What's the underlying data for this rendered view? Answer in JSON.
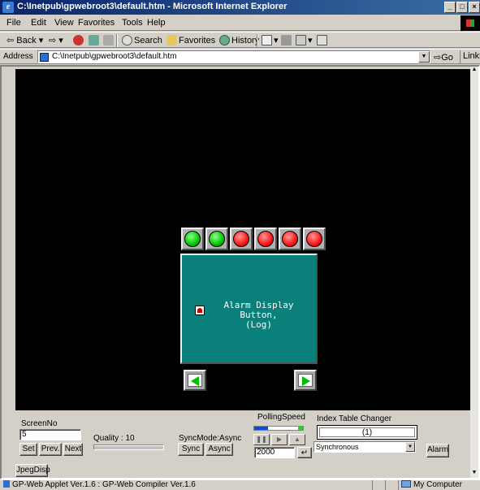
{
  "window": {
    "title": "C:\\Inetpub\\gpwebroot3\\default.htm - Microsoft Internet Explorer"
  },
  "menu": [
    "File",
    "Edit",
    "View",
    "Favorites",
    "Tools",
    "Help"
  ],
  "toolbar": {
    "back": "Back",
    "search": "Search",
    "favorites": "Favorites",
    "history": "History"
  },
  "address": {
    "label": "Address",
    "url": "C:\\Inetpub\\gpwebroot3\\default.htm",
    "go": "Go",
    "links": "Links"
  },
  "screen": {
    "lamps": [
      "green",
      "green",
      "red",
      "red",
      "red",
      "red"
    ],
    "alarm_line1": "Alarm Display Button,",
    "alarm_line2": "(Log)"
  },
  "applet": {
    "screen_no_label": "ScreenNo",
    "screen_no_value": "5",
    "set": "Set",
    "prev": "Prev.",
    "next": "Next",
    "quality_label": "Quality : 10",
    "syncmode_label": "SyncMode:Async",
    "sync": "Sync",
    "async": "Async",
    "polling_label": "PollingSpeed",
    "polling_value": "2000",
    "index_label": "Index Table Changer",
    "index_value": "(1)",
    "mode_value": "Synchronous",
    "alarm": "Alarm",
    "jpegdisp": "JpegDisp"
  },
  "status": {
    "text": "GP-Web Applet Ver.1.6  : GP-Web Compiler Ver.1.6",
    "zone": "My Computer"
  }
}
